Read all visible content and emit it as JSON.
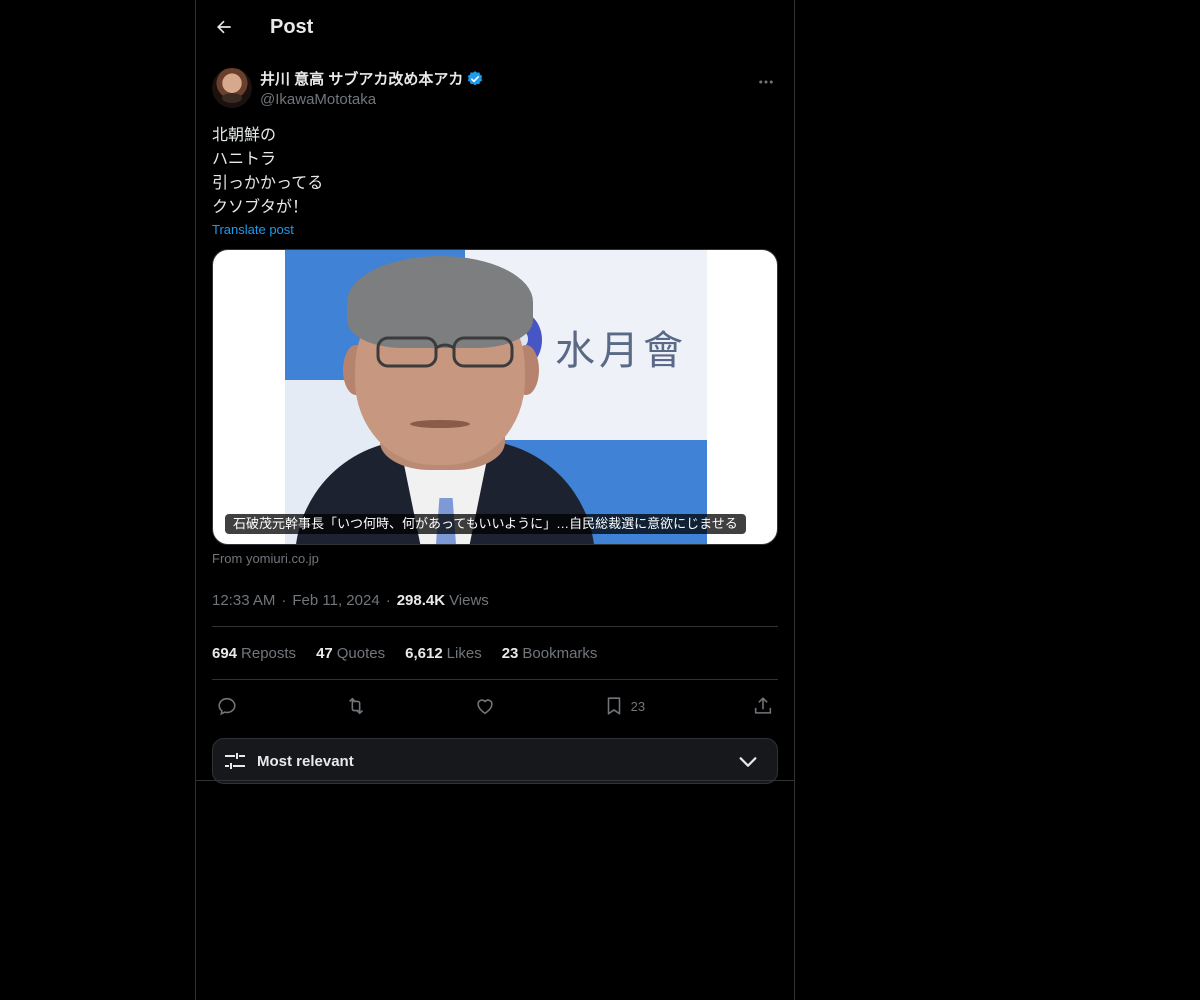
{
  "header": {
    "title": "Post",
    "back_icon": "arrow-left-icon"
  },
  "author": {
    "display_name": "井川 意高 サブアカ改め本アカ",
    "handle": "@IkawaMototaka",
    "verified": true,
    "verified_color": "#1d9bf0"
  },
  "post": {
    "lines": [
      "北朝鮮の",
      "ハニトラ",
      "引っかかってる",
      "クソブタが！"
    ],
    "translate_label": "Translate post"
  },
  "media": {
    "caption": "石破茂元幹事長「いつ何時、何があってもいいように」…自民総裁選に意欲にじませる",
    "banner_text": "水月會",
    "source": "From yomiuri.co.jp"
  },
  "meta": {
    "time": "12:33 AM",
    "date": "Feb 11, 2024",
    "separator": "·",
    "views_count": "298.4K",
    "views_label": "Views"
  },
  "stats": [
    {
      "count": "694",
      "label": "Reposts"
    },
    {
      "count": "47",
      "label": "Quotes"
    },
    {
      "count": "6,612",
      "label": "Likes"
    },
    {
      "count": "23",
      "label": "Bookmarks"
    }
  ],
  "actions": {
    "reply_icon": "reply-icon",
    "repost_icon": "repost-icon",
    "like_icon": "heart-icon",
    "bookmark_icon": "bookmark-icon",
    "bookmark_count": "23",
    "share_icon": "share-icon"
  },
  "sort": {
    "label": "Most relevant"
  },
  "colors": {
    "background": "#000000",
    "text": "#e7e9ea",
    "muted": "#71767b",
    "accent": "#1d9bf0",
    "border": "#2f3336"
  }
}
